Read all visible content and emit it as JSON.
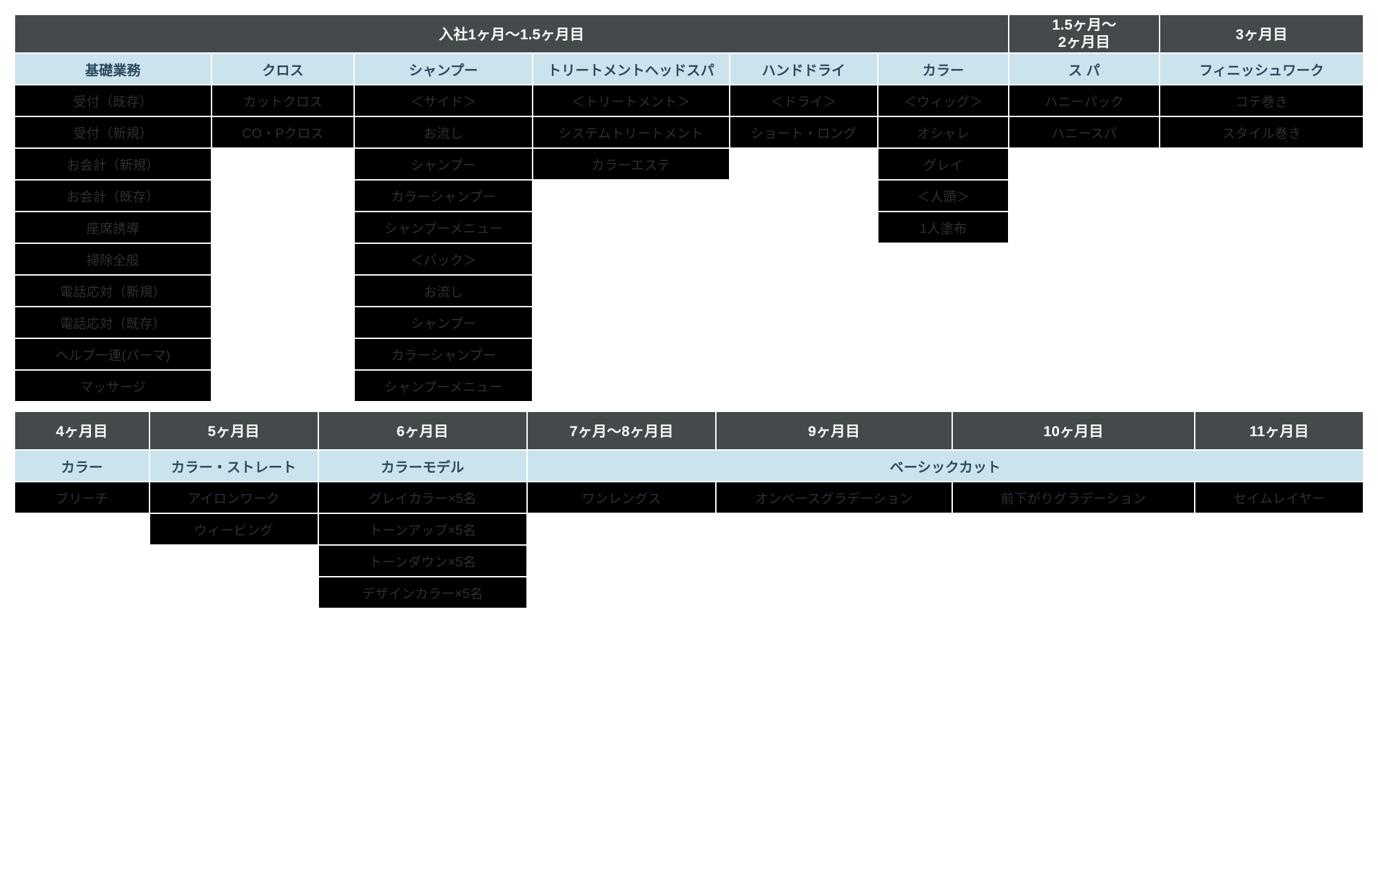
{
  "table1": {
    "top_headers": [
      "入社1ヶ月〜1.5ヶ月目",
      "1.5ヶ月〜\n2ヶ月目",
      "3ヶ月目"
    ],
    "sub_headers": [
      "基礎業務",
      "クロス",
      "シャンプー",
      "トリートメントヘッドスパ",
      "ハンドドライ",
      "カラー",
      "ス パ",
      "フィニッシュワーク"
    ],
    "cols": {
      "kiso": [
        "受付（既存）",
        "受付（新規）",
        "お会計（新規）",
        "お会計（既存）",
        "座席誘導",
        "掃除全般",
        "電話応対（新規）",
        "電話応対（既存）",
        "ヘルプ一連(パーマ)",
        "マッサージ"
      ],
      "cloth": [
        "カットクロス",
        "CO・Pクロス"
      ],
      "shampoo": [
        "＜サイド＞",
        "お流し",
        "シャンプー",
        "カラーシャンプー",
        "シャンプーメニュー",
        "＜バック＞",
        "お流し",
        "シャンプー",
        "カラーシャンプー",
        "シャンプーメニュー"
      ],
      "treatment": [
        "＜トリートメント＞",
        "システムトリートメント",
        "カラーエステ"
      ],
      "handdry": [
        "＜ドライ＞",
        "ショート・ロング"
      ],
      "color": [
        "＜ウィッグ＞",
        "オシャレ",
        "グレイ",
        "＜人頭＞",
        "1人塗布"
      ],
      "spa": [
        "ハニーパック",
        "ハニースパ"
      ],
      "finish": [
        "コテ巻き",
        "スタイル巻き"
      ]
    }
  },
  "table2": {
    "top_headers": [
      "4ヶ月目",
      "5ヶ月目",
      "6ヶ月目",
      "7ヶ月〜8ヶ月目",
      "9ヶ月目",
      "10ヶ月目",
      "11ヶ月目"
    ],
    "sub_headers": [
      "カラー",
      "カラー・ストレート",
      "カラーモデル",
      "ベーシックカット"
    ],
    "cols": {
      "m4": [
        "ブリーチ"
      ],
      "m5": [
        "アイロンワーク",
        "ウィービング"
      ],
      "m6": [
        "グレイカラー×5名",
        "トーンアップ×5名",
        "トーンダウン×5名",
        "デザインカラー×5名"
      ],
      "m7": [
        "ワンレングス"
      ],
      "m9": [
        "オンベースグラデーション"
      ],
      "m10": [
        "前下がりグラデーション"
      ],
      "m11": [
        "セイムレイヤー"
      ]
    }
  }
}
